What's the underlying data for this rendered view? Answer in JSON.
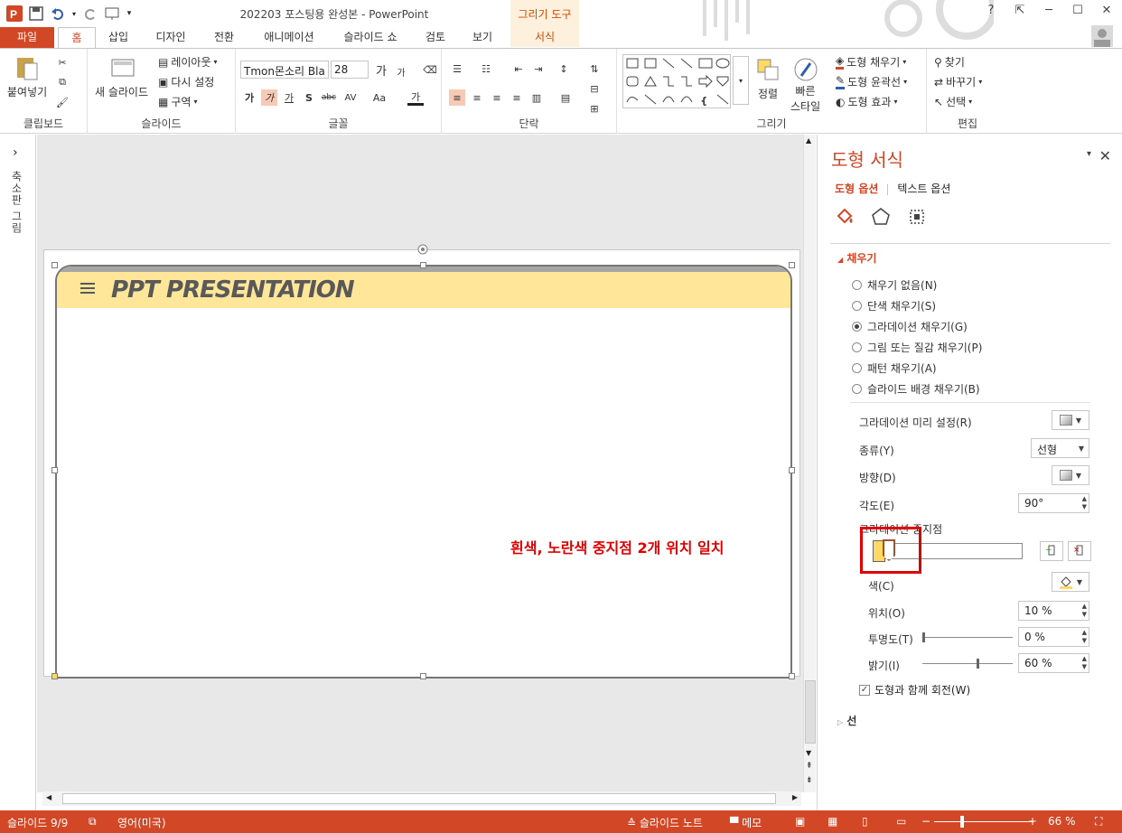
{
  "titlebar": {
    "doc_title": "202203 포스팅용 완성본 - PowerPoint",
    "context_group": "그리기 도구",
    "help": "?",
    "restore_ribbon": "⇱",
    "minimize": "─",
    "maximize": "☐",
    "close": "✕"
  },
  "tabs": [
    {
      "label": "파일"
    },
    {
      "label": "홈"
    },
    {
      "label": "삽입"
    },
    {
      "label": "디자인"
    },
    {
      "label": "전환"
    },
    {
      "label": "애니메이션"
    },
    {
      "label": "슬라이드 쇼"
    },
    {
      "label": "검토"
    },
    {
      "label": "보기"
    },
    {
      "label": "서식"
    }
  ],
  "ribbon": {
    "clipboard": {
      "paste": "붙여넣기",
      "label": "클립보드"
    },
    "slides": {
      "new_slide": "새 슬라이드",
      "layout": "레이아웃",
      "reset": "다시 설정",
      "section": "구역",
      "label": "슬라이드"
    },
    "font": {
      "family": "Tmon몬소리 Bla",
      "size": "28",
      "label": "글꼴",
      "grow": "가",
      "shrink": "가",
      "bold": "가",
      "italic": "가",
      "underline": "가",
      "shadow": "S",
      "strike": "abc",
      "spacing": "AV",
      "case": "Aa",
      "color": "가"
    },
    "paragraph": {
      "label": "단락"
    },
    "drawing": {
      "arrange": "정렬",
      "quick_style_1": "빠른",
      "quick_style_2": "스타일",
      "fill": "도형 채우기",
      "outline": "도형 윤곽선",
      "effects": "도형 효과",
      "label": "그리기"
    },
    "editing": {
      "find": "찾기",
      "replace": "바꾸기",
      "select": "선택",
      "label": "편집"
    }
  },
  "left_pane": {
    "expand": "›",
    "label": "축소판 그림"
  },
  "slide": {
    "title": "PPT PRESENTATION",
    "annotation": "흰색, 노란색 중지점 2개 위치 일치"
  },
  "format_pane": {
    "title": "도형 서식",
    "close": "✕",
    "menu": "▾",
    "tab_shape": "도형 옵션",
    "tab_text": "텍스트 옵션",
    "fill_section": "채우기",
    "fill_options": [
      {
        "label": "채우기 없음(N)",
        "selected": false
      },
      {
        "label": "단색 채우기(S)",
        "selected": false
      },
      {
        "label": "그라데이션 채우기(G)",
        "selected": true
      },
      {
        "label": "그림 또는 질감 채우기(P)",
        "selected": false
      },
      {
        "label": "패턴 채우기(A)",
        "selected": false
      },
      {
        "label": "슬라이드 배경 채우기(B)",
        "selected": false
      }
    ],
    "preset_label": "그라데이션 미리 설정(R)",
    "type_label": "종류(Y)",
    "type_value": "선형",
    "direction_label": "방향(D)",
    "angle_label": "각도(E)",
    "angle_value": "90°",
    "stops_label": "그라데이션 중지점",
    "color_label": "색(C)",
    "position_label": "위치(O)",
    "position_value": "10 %",
    "transparency_label": "투명도(T)",
    "transparency_value": "0 %",
    "transparency_level": 0,
    "brightness_label": "밝기(I)",
    "brightness_value": "60 %",
    "brightness_level": 60,
    "rotate_label": "도형과 함께 회전(W)",
    "rotate_checked": true,
    "line_section": "선",
    "stop_colors": {
      "white": "#ffffff",
      "yellow": "#ffd966"
    }
  },
  "status": {
    "slide_num": "슬라이드 9/9",
    "language": "영어(미국)",
    "notes": "슬라이드 노트",
    "comments": "메모",
    "zoom": "66 %",
    "zoom_minus": "−",
    "zoom_plus": "+"
  },
  "colors": {
    "accent": "#d24726",
    "slide_header": "#ffe699",
    "annotation": "#e00000"
  }
}
